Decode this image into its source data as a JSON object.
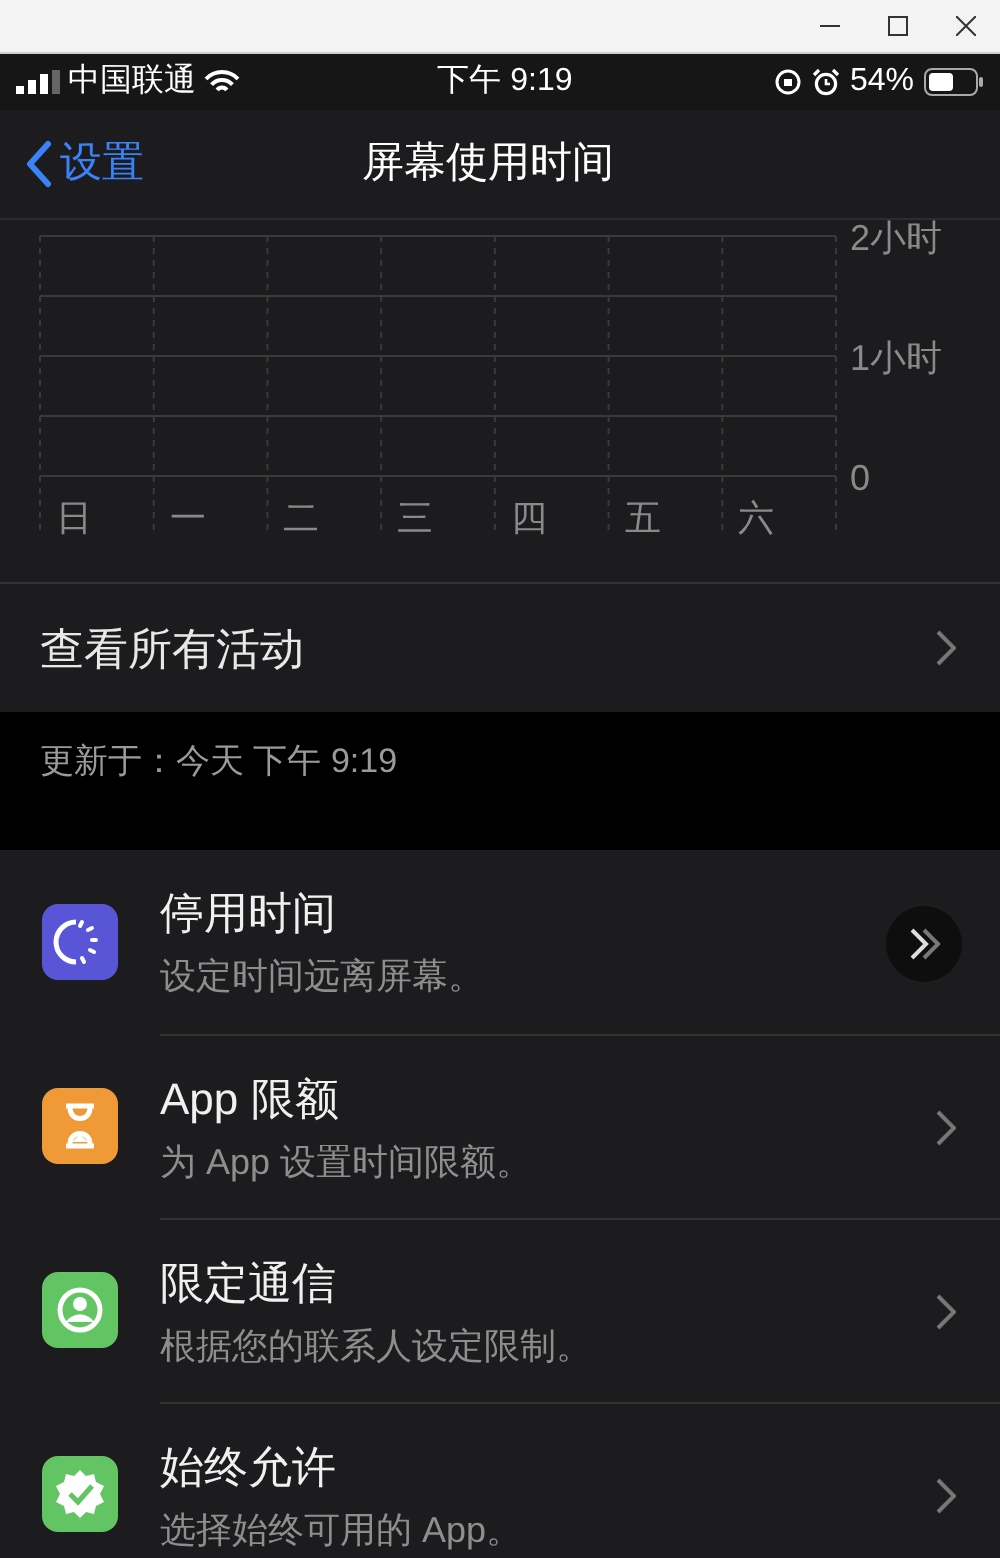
{
  "status_bar": {
    "carrier": "中国联通",
    "time": "下午 9:19",
    "battery": "54%"
  },
  "nav": {
    "back": "设置",
    "title": "屏幕使用时间"
  },
  "chart_data": {
    "type": "bar",
    "categories": [
      "日",
      "一",
      "二",
      "三",
      "四",
      "五",
      "六"
    ],
    "values": [
      0,
      0,
      0,
      0,
      0,
      0,
      0
    ],
    "ylim": [
      0,
      2
    ],
    "yticks": [
      {
        "value": 0,
        "label": "0"
      },
      {
        "value": 1,
        "label": "1小时"
      },
      {
        "value": 2,
        "label": "2小时"
      }
    ]
  },
  "see_all": "查看所有活动",
  "updated": "更新于：今天 下午 9:19",
  "items": [
    {
      "kind": "downtime",
      "title": "停用时间",
      "subtitle": "设定时间远离屏幕。",
      "color": "#5856d6"
    },
    {
      "kind": "limits",
      "title": "App 限额",
      "subtitle": "为 App 设置时间限额。",
      "color": "#f09a37"
    },
    {
      "kind": "contacts",
      "title": "限定通信",
      "subtitle": "根据您的联系人设定限制。",
      "color": "#62c462"
    },
    {
      "kind": "allowed",
      "title": "始终允许",
      "subtitle": "选择始终可用的 App。",
      "color": "#62c462"
    }
  ]
}
